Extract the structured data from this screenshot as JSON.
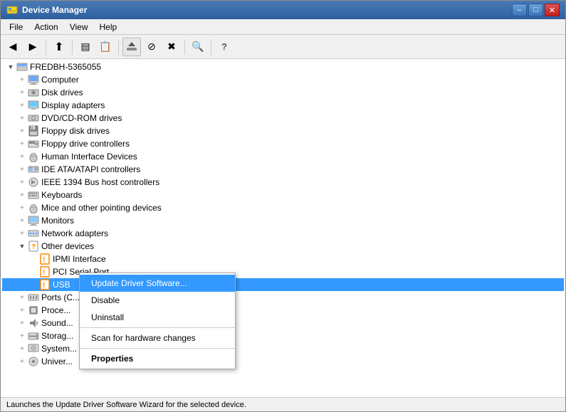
{
  "window": {
    "title": "Device Manager",
    "min_label": "–",
    "max_label": "□",
    "close_label": "✕"
  },
  "menu": {
    "items": [
      "File",
      "Action",
      "View",
      "Help"
    ]
  },
  "toolbar": {
    "buttons": [
      {
        "name": "back-btn",
        "icon": "◀",
        "label": "Back"
      },
      {
        "name": "forward-btn",
        "icon": "▶",
        "label": "Forward"
      },
      {
        "name": "up-btn",
        "icon": "⬆",
        "label": "Up"
      },
      {
        "name": "show-hide-btn",
        "icon": "▤",
        "label": "Show/Hide"
      },
      {
        "name": "properties-btn",
        "icon": "📋",
        "label": "Properties"
      },
      {
        "name": "update-driver-btn",
        "icon": "↑",
        "label": "Update Driver"
      },
      {
        "name": "disable-btn",
        "icon": "⊘",
        "label": "Disable"
      },
      {
        "name": "uninstall-btn",
        "icon": "✖",
        "label": "Uninstall"
      },
      {
        "name": "scan-btn",
        "icon": "🔍",
        "label": "Scan for hardware changes"
      },
      {
        "name": "help-btn",
        "icon": "?",
        "label": "Help"
      }
    ]
  },
  "tree": {
    "root": "FREDBH-5365055",
    "items": [
      {
        "id": "root",
        "label": "FREDBH-5365055",
        "indent": 0,
        "expanded": true,
        "icon": "💻",
        "expand_sign": "▼"
      },
      {
        "id": "computer",
        "label": "Computer",
        "indent": 1,
        "expanded": false,
        "icon": "🖥",
        "expand_sign": "+"
      },
      {
        "id": "disk",
        "label": "Disk drives",
        "indent": 1,
        "expanded": false,
        "icon": "💾",
        "expand_sign": "+"
      },
      {
        "id": "display",
        "label": "Display adapters",
        "indent": 1,
        "expanded": false,
        "icon": "🖥",
        "expand_sign": "+"
      },
      {
        "id": "dvd",
        "label": "DVD/CD-ROM drives",
        "indent": 1,
        "expanded": false,
        "icon": "💿",
        "expand_sign": "+"
      },
      {
        "id": "floppy",
        "label": "Floppy disk drives",
        "indent": 1,
        "expanded": false,
        "icon": "💾",
        "expand_sign": "+"
      },
      {
        "id": "floppy-ctrl",
        "label": "Floppy drive controllers",
        "indent": 1,
        "expanded": false,
        "icon": "🔧",
        "expand_sign": "+"
      },
      {
        "id": "hid",
        "label": "Human Interface Devices",
        "indent": 1,
        "expanded": false,
        "icon": "🖱",
        "expand_sign": "+"
      },
      {
        "id": "ide",
        "label": "IDE ATA/ATAPI controllers",
        "indent": 1,
        "expanded": false,
        "icon": "⚙",
        "expand_sign": "+"
      },
      {
        "id": "ieee",
        "label": "IEEE 1394 Bus host controllers",
        "indent": 1,
        "expanded": false,
        "icon": "🔌",
        "expand_sign": "+"
      },
      {
        "id": "keyboards",
        "label": "Keyboards",
        "indent": 1,
        "expanded": false,
        "icon": "⌨",
        "expand_sign": "+"
      },
      {
        "id": "mice",
        "label": "Mice and other pointing devices",
        "indent": 1,
        "expanded": false,
        "icon": "🖱",
        "expand_sign": "+"
      },
      {
        "id": "monitors",
        "label": "Monitors",
        "indent": 1,
        "expanded": false,
        "icon": "🖥",
        "expand_sign": "+"
      },
      {
        "id": "network",
        "label": "Network adapters",
        "indent": 1,
        "expanded": false,
        "icon": "🌐",
        "expand_sign": "+"
      },
      {
        "id": "other",
        "label": "Other devices",
        "indent": 1,
        "expanded": true,
        "icon": "❓",
        "expand_sign": "▼"
      },
      {
        "id": "ipmi",
        "label": "IPMI Interface",
        "indent": 2,
        "expanded": false,
        "icon": "🔧",
        "expand_sign": ""
      },
      {
        "id": "pci",
        "label": "PCI Serial Port",
        "indent": 2,
        "expanded": false,
        "icon": "🔧",
        "expand_sign": ""
      },
      {
        "id": "usb",
        "label": "USB",
        "indent": 2,
        "expanded": false,
        "icon": "🔧",
        "expand_sign": "",
        "selected": true
      },
      {
        "id": "ports",
        "label": "Ports (C...",
        "indent": 1,
        "expanded": false,
        "icon": "🔌",
        "expand_sign": "+"
      },
      {
        "id": "proc",
        "label": "Proce...",
        "indent": 1,
        "expanded": false,
        "icon": "⚙",
        "expand_sign": "+"
      },
      {
        "id": "sound",
        "label": "Sound...",
        "indent": 1,
        "expanded": false,
        "icon": "🔊",
        "expand_sign": "+"
      },
      {
        "id": "storage",
        "label": "Storag...",
        "indent": 1,
        "expanded": false,
        "icon": "💾",
        "expand_sign": "+"
      },
      {
        "id": "system",
        "label": "System...",
        "indent": 1,
        "expanded": false,
        "icon": "⚙",
        "expand_sign": "+"
      },
      {
        "id": "univer",
        "label": "Univer...",
        "indent": 1,
        "expanded": false,
        "icon": "🔌",
        "expand_sign": "+"
      }
    ]
  },
  "context_menu": {
    "items": [
      {
        "id": "update",
        "label": "Update Driver Software...",
        "bold": false,
        "highlighted": true
      },
      {
        "id": "disable",
        "label": "Disable",
        "bold": false
      },
      {
        "id": "uninstall",
        "label": "Uninstall",
        "bold": false
      },
      {
        "id": "sep1",
        "separator": true
      },
      {
        "id": "scan",
        "label": "Scan for hardware changes",
        "bold": false
      },
      {
        "id": "sep2",
        "separator": true
      },
      {
        "id": "properties",
        "label": "Properties",
        "bold": true
      }
    ]
  },
  "status_bar": {
    "text": "Launches the Update Driver Software Wizard for the selected device."
  }
}
